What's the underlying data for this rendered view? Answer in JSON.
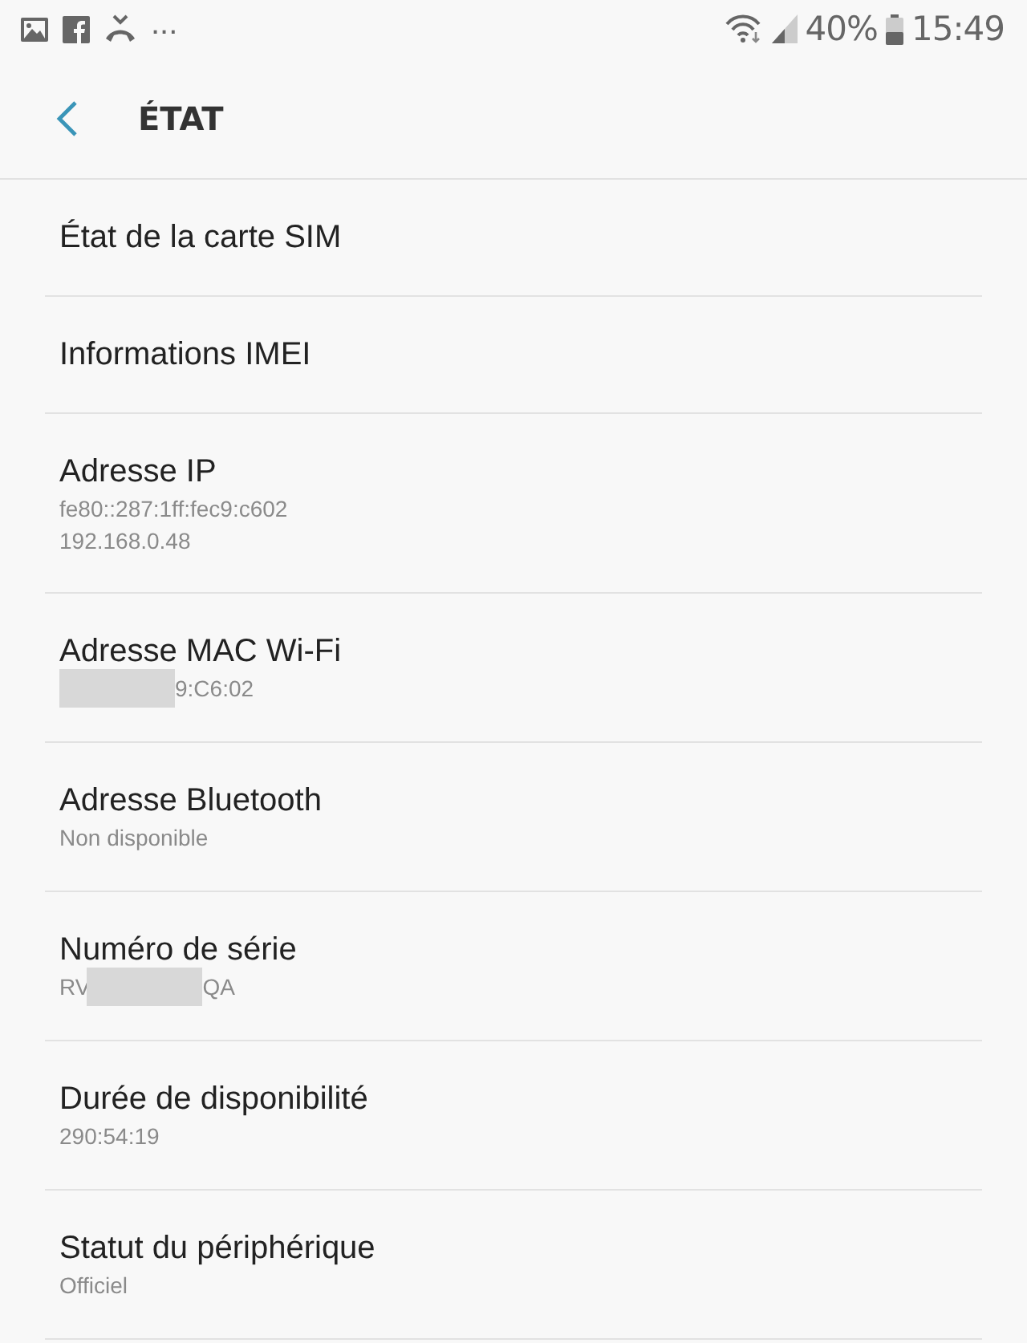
{
  "status_bar": {
    "notifications_more": "...",
    "battery": "40%",
    "time": "15:49"
  },
  "header": {
    "title": "ÉTAT"
  },
  "items": [
    {
      "title": "État de la carte SIM"
    },
    {
      "title": "Informations IMEI"
    },
    {
      "title": "Adresse IP",
      "summary": [
        [
          {
            "kind": "text",
            "text": "fe80::287:1ff:fec9:c602"
          }
        ],
        [
          {
            "kind": "text",
            "text": "192.168.0.48"
          }
        ]
      ]
    },
    {
      "title": "Adresse MAC Wi-Fi",
      "summary": [
        [
          {
            "kind": "redacted"
          },
          {
            "kind": "text",
            "text": "9:C6:02"
          }
        ]
      ]
    },
    {
      "title": "Adresse Bluetooth",
      "summary": [
        [
          {
            "kind": "text",
            "text": "Non disponible"
          }
        ]
      ]
    },
    {
      "title": "Numéro de série",
      "summary": [
        [
          {
            "kind": "text",
            "text": "RV"
          },
          {
            "kind": "redacted"
          },
          {
            "kind": "text",
            "text": "QA"
          }
        ]
      ]
    },
    {
      "title": "Durée de disponibilité",
      "summary": [
        [
          {
            "kind": "text",
            "text": "290:54:19"
          }
        ]
      ]
    },
    {
      "title": "Statut du périphérique",
      "summary": [
        [
          {
            "kind": "text",
            "text": "Officiel"
          }
        ]
      ]
    }
  ]
}
